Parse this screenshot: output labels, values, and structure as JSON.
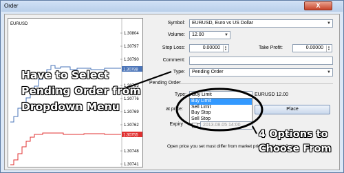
{
  "window": {
    "title": "Order",
    "close_label": "X"
  },
  "chart": {
    "symbol": "EURUSD",
    "prices": [
      "1.30804",
      "1.30797",
      "1.30790",
      "1.30788",
      "1.30783",
      "1.30776",
      "1.30769",
      "1.30762",
      "1.30755",
      "1.30748",
      "1.30741"
    ],
    "bid_highlight": "1.30788",
    "ask_highlight": "1.30755",
    "bid_color": "#4a74b8",
    "ask_color": "#e03030"
  },
  "form": {
    "symbol_label": "Symbol:",
    "symbol_value": "EURUSD, Euro vs US Dollar",
    "volume_label": "Volume:",
    "volume_value": "12.00",
    "stoploss_label": "Stop Loss:",
    "stoploss_value": "0.00000",
    "takeprofit_label": "Take Profit:",
    "takeprofit_value": "0.00000",
    "comment_label": "Comment:",
    "comment_value": "",
    "type_label": "Type:",
    "type_value": "Pending Order"
  },
  "pending": {
    "group_label": "Pending Order",
    "type_label": "Type:",
    "type_value": "Buy Limit",
    "summary": "EURUSD 12.00",
    "price_label": "at price:",
    "place_label": "Place",
    "expiry_label": "Expiry",
    "expiry_value": "2013.08.05 14:00",
    "options": [
      "Buy Limit",
      "Sell Limit",
      "Buy Stop",
      "Sell Stop"
    ],
    "selected_index": 0,
    "note": "Open price you set must differ from market price by at least 0 pips."
  },
  "annotations": {
    "left": "Have to Select Pending Order from Dropdown Menu",
    "right": "4 Options to Choose From"
  }
}
